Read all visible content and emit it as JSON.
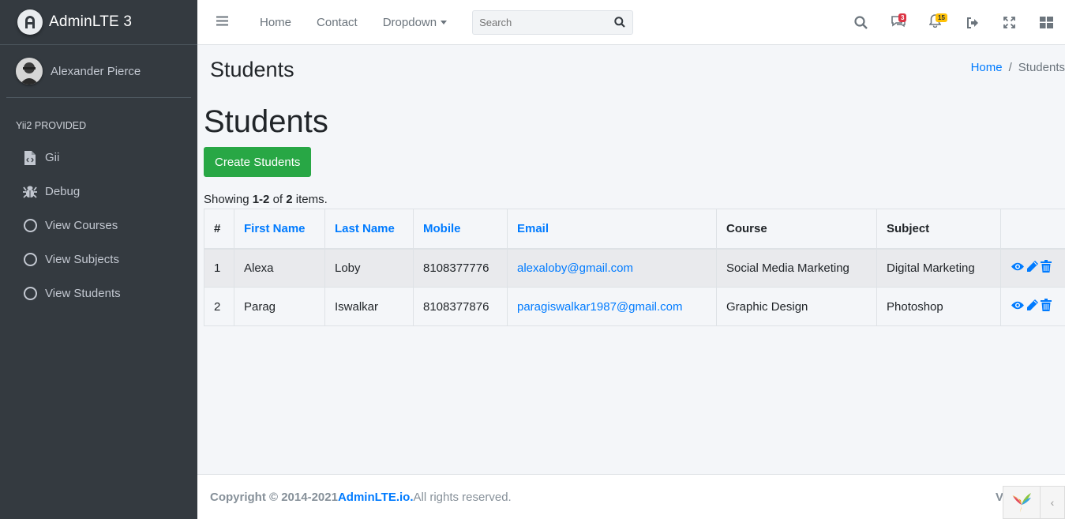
{
  "brand": {
    "name": "AdminLTE 3"
  },
  "user": {
    "name": "Alexander Pierce"
  },
  "sidebar": {
    "header": "Yii2 PROVIDED",
    "items": [
      {
        "label": "Gii",
        "icon": "file-code-icon"
      },
      {
        "label": "Debug",
        "icon": "bug-icon"
      },
      {
        "label": "View Courses",
        "icon": "circle-icon"
      },
      {
        "label": "View Subjects",
        "icon": "circle-icon"
      },
      {
        "label": "View Students",
        "icon": "circle-icon"
      }
    ]
  },
  "navbar": {
    "links": [
      "Home",
      "Contact",
      "Dropdown"
    ],
    "search_placeholder": "Search",
    "messages_badge": "3",
    "notifications_badge": "15"
  },
  "content_header": {
    "title": "Students",
    "breadcrumb": {
      "home": "Home",
      "separator": "/",
      "current": "Students"
    }
  },
  "page": {
    "title": "Students",
    "create_button": "Create Students",
    "summary": {
      "prefix": "Showing ",
      "range": "1-2",
      "of": " of ",
      "total": "2",
      "suffix": " items."
    }
  },
  "table": {
    "headers": [
      "#",
      "First Name",
      "Last Name",
      "Mobile",
      "Email",
      "Course",
      "Subject",
      ""
    ],
    "rows": [
      {
        "num": "1",
        "first": "Alexa",
        "last": "Loby",
        "mobile": "8108377776",
        "email": "alexaloby@gmail.com",
        "course": "Social Media Marketing",
        "subject": "Digital Marketing"
      },
      {
        "num": "2",
        "first": "Parag",
        "last": "Iswalkar",
        "mobile": "8108377876",
        "email": "paragiswalkar1987@gmail.com",
        "course": "Graphic Design",
        "subject": "Photoshop"
      }
    ]
  },
  "footer": {
    "copyright": "Copyright © 2014-2021 ",
    "link": "AdminLTE.io.",
    "rights": " All rights reserved.",
    "version_label": "V"
  },
  "colors": {
    "sidebar": "#343a40",
    "primary": "#007bff",
    "success": "#28a745",
    "danger": "#dc3545",
    "warning": "#ffc107"
  }
}
